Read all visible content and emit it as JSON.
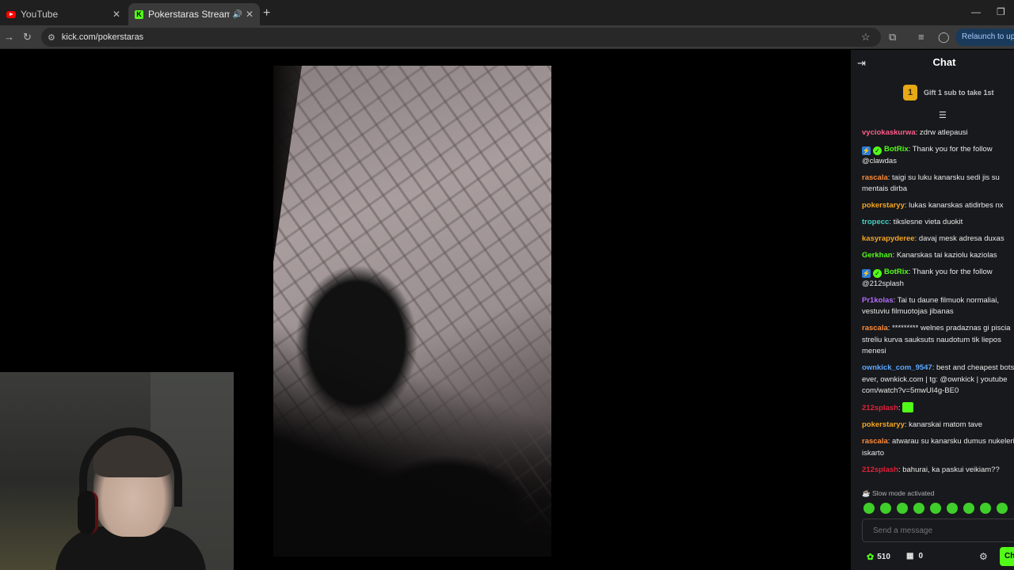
{
  "browser": {
    "tabs": [
      {
        "title": "YouTube",
        "icon": "youtube-icon"
      },
      {
        "title": "Pokerstaras Stream - Watch",
        "icon": "kick-icon"
      }
    ],
    "url": "kick.com/pokerstaras",
    "relaunch_label": "Relaunch to update"
  },
  "chat": {
    "title": "Chat",
    "gift_rank": "1",
    "gift_text": "Gift 1 sub to take 1st",
    "messages": [
      {
        "user": "vyciokaskurwa",
        "color": "#ff5c8a",
        "text": ": zdrw atlepausi"
      },
      {
        "user": "BotRix",
        "color": "#53fc18",
        "badges": [
          "bot",
          "verified"
        ],
        "text": ": Thank you for the follow @clawdas"
      },
      {
        "user": "rascala",
        "color": "#ff8c3a",
        "text": ": taigi su luku kanarsku sedi jis su mentais dirba"
      },
      {
        "user": "pokerstaryy",
        "color": "#f5a623",
        "text": ": lukas kanarskas atidirbes nx"
      },
      {
        "user": "tropecc",
        "color": "#45d1c4",
        "text": ": tikslesne vieta duokit"
      },
      {
        "user": "kasyrapyderee",
        "color": "#f5a623",
        "text": ": davaj mesk adresa duxas"
      },
      {
        "user": "Gerkhan",
        "color": "#53fc18",
        "text": ": Kanarskas tai kaziolu kaziolas"
      },
      {
        "user": "BotRix",
        "color": "#53fc18",
        "badges": [
          "bot",
          "verified"
        ],
        "text": ": Thank you for the follow @212splash"
      },
      {
        "user": "Pr1kolas",
        "color": "#b36bff",
        "text": ": Tai tu daune filmuok normaliai, vestuviu filmuotojas jibanas"
      },
      {
        "user": "rascala",
        "color": "#ff8c3a",
        "text": ": ********* welnes pradaznas gi piscia streliu kurva sauksuts naudotum tik liepos menesi"
      },
      {
        "user": "ownkick_com_9547",
        "color": "#5aa8ff",
        "text": ": best and cheapest bots ever, ownkick.com | tg: @ownkick | youtube com/watch?v=5mwUI4g-BE0"
      },
      {
        "user": "212splash",
        "color": "#e0203a",
        "text": ": ",
        "emote": true
      },
      {
        "user": "pokerstaryy",
        "color": "#f5a623",
        "text": ": kanarskai matom tave"
      },
      {
        "user": "rascala",
        "color": "#ff8c3a",
        "text": ": atwarau su kanarsku dumus nukeleri iskarto"
      },
      {
        "user": "212splash",
        "color": "#e0203a",
        "text": ": bahurai, ka paskui veikiam??"
      }
    ],
    "slow_mode": "Slow mode activated",
    "input_placeholder": "Send a message",
    "points": "510",
    "store_count": "0",
    "chat_button": "Chat"
  }
}
